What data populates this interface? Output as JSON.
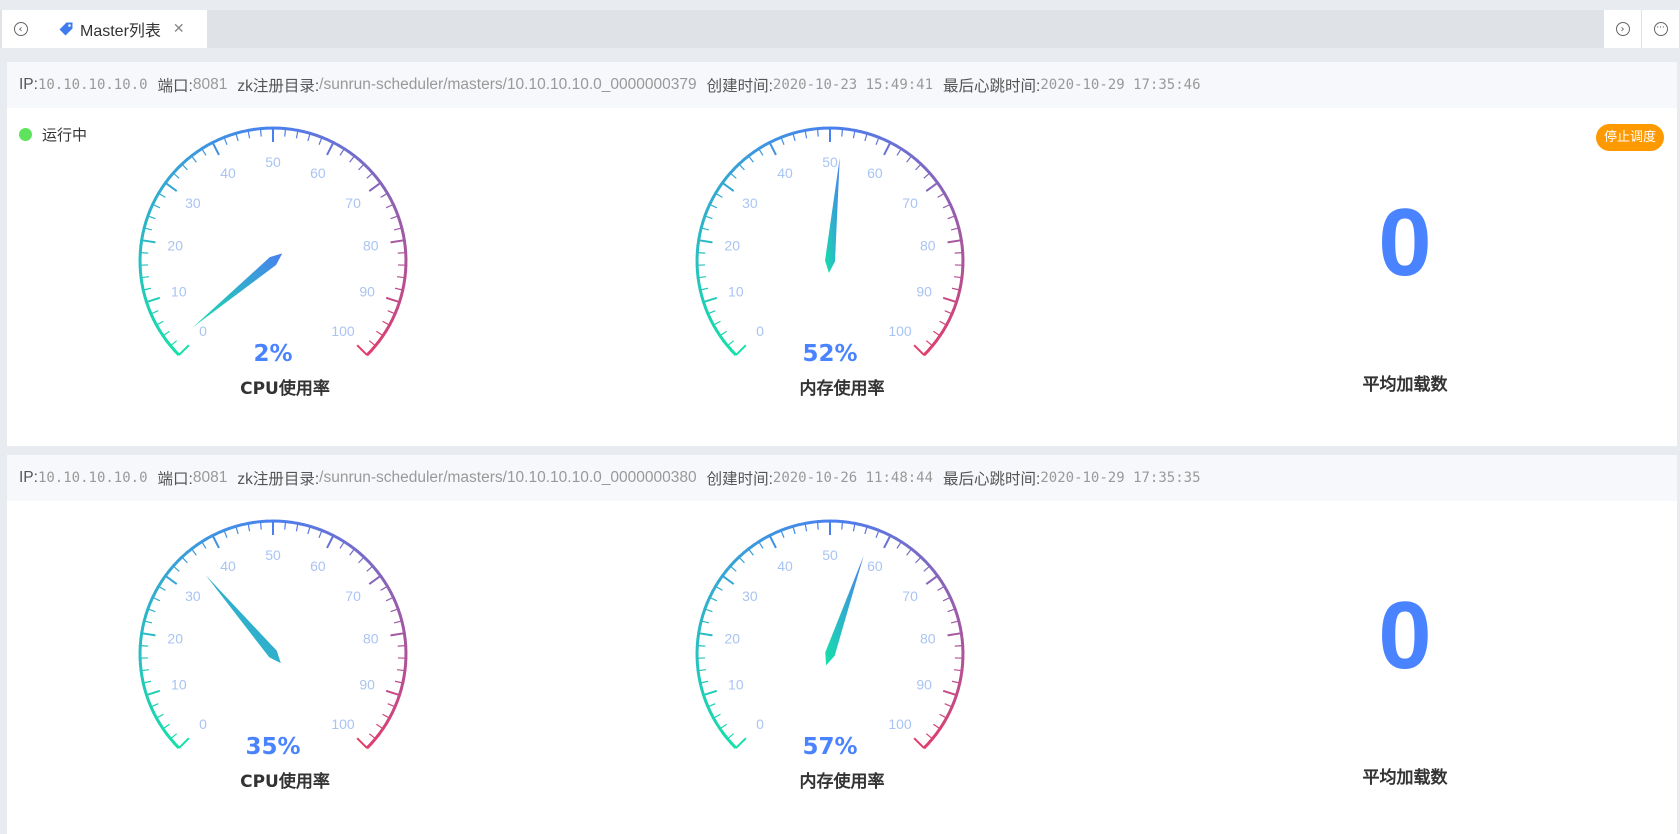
{
  "tabbar": {
    "tabs": [
      {
        "label": "Master列表"
      }
    ],
    "prev_icon": "chevron-left-circle-icon",
    "next_icon": "chevron-right-circle-icon",
    "more_icon": "more-circle-icon"
  },
  "labels": {
    "ip": "IP: ",
    "port": "端口: ",
    "zk": "zk注册目录: ",
    "created": "创建时间: ",
    "heartbeat": "最后心跳时间: ",
    "cpu": "CPU使用率",
    "mem": "内存使用率",
    "load": "平均加载数"
  },
  "colors": {
    "accent": "#4a83ff",
    "running": "#5fe35f",
    "stop": "#ff9900",
    "gauge_start": "#15e0a9",
    "gauge_mid": "#4a7ff0",
    "gauge_end": "#e23c6b"
  },
  "masters": [
    {
      "ip": "10.10.10.10.0",
      "port": "8081",
      "zk_path": "/sunrun-scheduler/masters/10.10.10.10.0_0000000379",
      "created": "2020-10-23 15:49:41",
      "heartbeat": "2020-10-29 17:35:46",
      "status": "运行中",
      "stop_label": "停止调度",
      "cpu": 2,
      "cpu_text": "2%",
      "mem": 52,
      "mem_text": "52%",
      "load": "0"
    },
    {
      "ip": "10.10.10.10.0",
      "port": "8081",
      "zk_path": "/sunrun-scheduler/masters/10.10.10.10.0_0000000380",
      "created": "2020-10-26 11:48:44",
      "heartbeat": "2020-10-29 17:35:35",
      "cpu": 35,
      "cpu_text": "35%",
      "mem": 57,
      "mem_text": "57%",
      "load": "0"
    }
  ]
}
